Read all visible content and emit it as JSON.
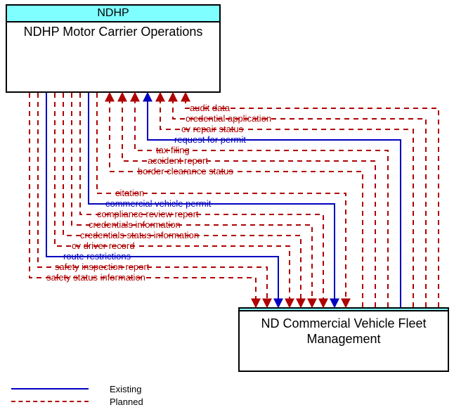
{
  "diagram": {
    "top_node": {
      "header": "NDHP",
      "title": "NDHP Motor Carrier Operations"
    },
    "bottom_node": {
      "header": "",
      "title": "ND Commercial Vehicle Fleet Management"
    },
    "flows_to_top": [
      {
        "label": "audit data",
        "status": "planned"
      },
      {
        "label": "credential application",
        "status": "planned"
      },
      {
        "label": "cv repair status",
        "status": "planned"
      },
      {
        "label": "request for permit",
        "status": "existing"
      },
      {
        "label": "tax filing",
        "status": "planned"
      },
      {
        "label": "accident report",
        "status": "planned"
      },
      {
        "label": "border clearance status",
        "status": "planned"
      }
    ],
    "flows_to_bottom": [
      {
        "label": "citation",
        "status": "planned"
      },
      {
        "label": "commercial vehicle permit",
        "status": "existing"
      },
      {
        "label": "compliance review report",
        "status": "planned"
      },
      {
        "label": "credentials information",
        "status": "planned"
      },
      {
        "label": "credentials status information",
        "status": "planned"
      },
      {
        "label": "cv driver record",
        "status": "planned"
      },
      {
        "label": "route restrictions",
        "status": "existing"
      },
      {
        "label": "safety inspection report",
        "status": "planned"
      },
      {
        "label": "safety status information",
        "status": "planned"
      }
    ],
    "legend": {
      "existing": "Existing",
      "planned": "Planned"
    },
    "colors": {
      "existing": "#0000c0",
      "planned": "#b00000",
      "node_header_bg": "#7FFFFF"
    }
  }
}
